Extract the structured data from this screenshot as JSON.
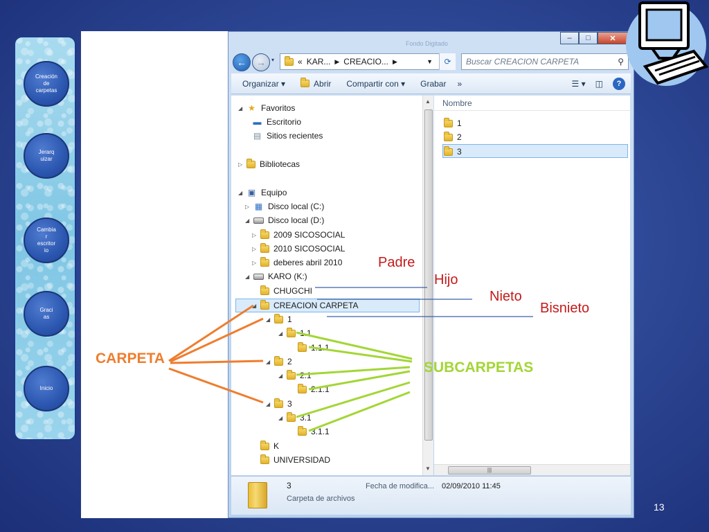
{
  "nav": {
    "buttons": [
      "Creación\nde\ncarpetas",
      "Jerarq\nuizar",
      "Cambia\nr\nescritor\nio",
      "Graci\nas",
      "Inicio"
    ]
  },
  "window": {
    "ghost_title": "Fondo Digitado",
    "address": {
      "crumb1": "KAR...",
      "crumb2": "CREACIO..."
    },
    "search_placeholder": "Buscar CREACION CARPETA",
    "toolbar": {
      "organizar": "Organizar ▾",
      "abrir": "Abrir",
      "compartir": "Compartir con ▾",
      "grabar": "Grabar",
      "more": "»"
    },
    "tree": {
      "favoritos": "Favoritos",
      "escritorio": "Escritorio",
      "sitios": "Sitios recientes",
      "bibliotecas": "Bibliotecas",
      "equipo": "Equipo",
      "disco_c": "Disco local (C:)",
      "disco_d": "Disco local (D:)",
      "f2009": "2009 SICOSOCIAL",
      "f2010": "2010 SICOSOCIAL",
      "deberes": "deberes abril 2010",
      "karo": "KARO (K:)",
      "chugchi": "CHUGCHI",
      "creacion": "CREACION CARPETA",
      "n1": "1",
      "n11": "1.1",
      "n111": "1.1.1",
      "n2": "2",
      "n21": "2.1",
      "n211": "2.1.1",
      "n3": "3",
      "n31": "3.1",
      "n311": "3.1.1",
      "k": "K",
      "universidad": "UNIVERSIDAD"
    },
    "content": {
      "col_nombre": "Nombre",
      "items": [
        "1",
        "2",
        "3"
      ]
    },
    "details": {
      "name": "3",
      "type": "Carpeta de archivos",
      "mod_label": "Fecha de modifica...",
      "mod_value": "02/09/2010 11:45"
    }
  },
  "annotations": {
    "padre": "Padre",
    "hijo": "Hijo",
    "nieto": "Nieto",
    "bisnieto": "Bisnieto",
    "carpeta": "CARPETA",
    "subcarpetas": "SUBCARPETAS"
  },
  "colors": {
    "orange": "#ef7d2e",
    "green": "#a3d635",
    "red": "#c41a1a"
  },
  "slide_number": "13"
}
